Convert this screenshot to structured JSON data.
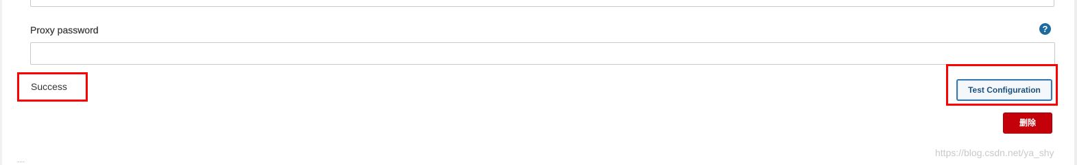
{
  "proxy_password": {
    "label": "Proxy password",
    "value": "",
    "placeholder": "",
    "help_icon": "question-mark-icon"
  },
  "status": {
    "text": "Success"
  },
  "actions": {
    "test_label": "Test Configuration",
    "delete_label": "删除"
  },
  "colors": {
    "highlight": "#ff0000",
    "help": "#1d6a9e",
    "delete_bg": "#c4000a",
    "test_border": "#3a79ad"
  },
  "footer": {
    "ellipsis": "....",
    "watermark": "https://blog.csdn.net/ya_shy"
  }
}
